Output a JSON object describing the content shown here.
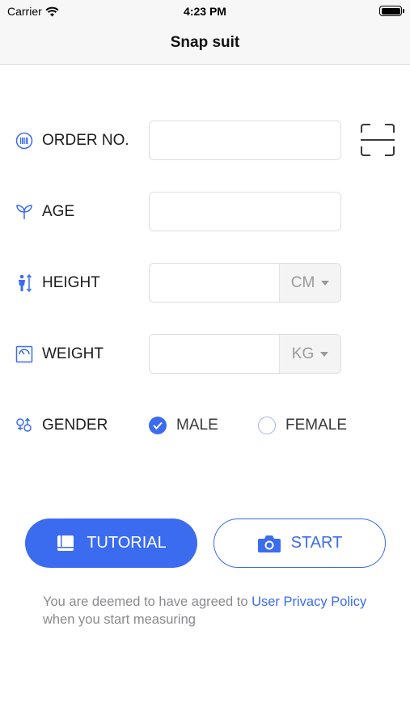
{
  "status_bar": {
    "carrier": "Carrier",
    "time": "4:23 PM"
  },
  "nav": {
    "title": "Snap suit"
  },
  "form": {
    "order_no": {
      "label": "ORDER NO.",
      "value": "",
      "icon": "barcode-icon"
    },
    "age": {
      "label": "AGE",
      "value": "",
      "icon": "sprout-icon"
    },
    "height": {
      "label": "HEIGHT",
      "value": "",
      "unit": "CM",
      "icon": "height-measure-icon"
    },
    "weight": {
      "label": "WEIGHT",
      "value": "",
      "unit": "KG",
      "icon": "scale-icon"
    },
    "gender": {
      "label": "GENDER",
      "icon": "gender-icon",
      "options": [
        {
          "label": "MALE",
          "selected": true
        },
        {
          "label": "FEMALE",
          "selected": false
        }
      ]
    }
  },
  "buttons": {
    "tutorial": "TUTORIAL",
    "start": "START"
  },
  "agreement": {
    "prefix": "You are deemed to have agreed to ",
    "link": "User Privacy Policy",
    "suffix": " when you start measuring"
  },
  "colors": {
    "accent": "#3b6cf0",
    "text": "#1c1c1e",
    "muted": "#8a8a8e"
  }
}
